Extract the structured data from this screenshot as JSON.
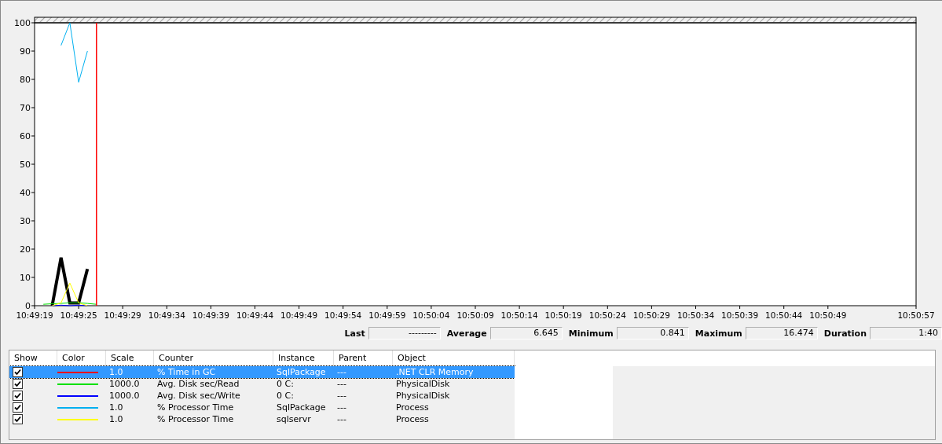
{
  "chart": {
    "cursor": {
      "level": 0.07
    },
    "chart_data": {
      "type": "line",
      "ylim": [
        0,
        100
      ],
      "yticks": [
        0,
        10,
        20,
        30,
        40,
        50,
        60,
        70,
        80,
        90,
        100
      ],
      "categories": [
        "10:49:19",
        null,
        null,
        null,
        null,
        "10:49:25",
        null,
        null,
        null,
        null,
        "10:49:29",
        null,
        null,
        null,
        null,
        "10:49:34",
        null,
        null,
        null,
        null,
        "10:49:39",
        null,
        null,
        null,
        null,
        "10:49:44",
        null,
        null,
        null,
        null,
        "10:49:49",
        null,
        null,
        null,
        null,
        "10:49:54",
        null,
        null,
        null,
        null,
        "10:49:59",
        null,
        null,
        null,
        null,
        "10:50:04",
        null,
        null,
        null,
        null,
        "10:50:09",
        null,
        null,
        null,
        null,
        "10:50:14",
        null,
        null,
        null,
        null,
        "10:50:19",
        null,
        null,
        null,
        null,
        "10:50:24",
        null,
        null,
        null,
        null,
        "10:50:29",
        null,
        null,
        null,
        null,
        "10:50:34",
        null,
        null,
        null,
        null,
        "10:50:39",
        null,
        null,
        null,
        null,
        "10:50:44",
        null,
        null,
        null,
        null,
        "10:50:49",
        null,
        null,
        null,
        null,
        null,
        null,
        null,
        null,
        null,
        "10:50:57"
      ],
      "series": [
        {
          "color": "#000000",
          "values": [
            null,
            null,
            0,
            17,
            1,
            1,
            13,
            null,
            null,
            null,
            null,
            null,
            null,
            null,
            null,
            null,
            null,
            null,
            null,
            null,
            null,
            null,
            null,
            null,
            null,
            null,
            null,
            null,
            null,
            null,
            null,
            null,
            null,
            null,
            null,
            null,
            null,
            null,
            null,
            null,
            null,
            null,
            null,
            null,
            null,
            null,
            null,
            null,
            null,
            null,
            null,
            null,
            null,
            null,
            null,
            null,
            null,
            null,
            null,
            null,
            null,
            null,
            null,
            null,
            null,
            null,
            null,
            null,
            null,
            null,
            null,
            null,
            null,
            null,
            null,
            null,
            null,
            null,
            null,
            null,
            null,
            null,
            null,
            null,
            null,
            null,
            null,
            null,
            null,
            null,
            null,
            null,
            null,
            null,
            null,
            null,
            null,
            null,
            null,
            null,
            null
          ]
        },
        {
          "color": "#00e000",
          "values": [
            null,
            0.5,
            0.7,
            0.8,
            1,
            1,
            0.8,
            0.5,
            null,
            null,
            null,
            null,
            null,
            null,
            null,
            null,
            null,
            null,
            null,
            null,
            null,
            null,
            null,
            null,
            null,
            null,
            null,
            null,
            null,
            null,
            null,
            null,
            null,
            null,
            null,
            null,
            null,
            null,
            null,
            null,
            null,
            null,
            null,
            null,
            null,
            null,
            null,
            null,
            null,
            null,
            null,
            null,
            null,
            null,
            null,
            null,
            null,
            null,
            null,
            null,
            null,
            null,
            null,
            null,
            null,
            null,
            null,
            null,
            null,
            null,
            null,
            null,
            null,
            null,
            null,
            null,
            null,
            null,
            null,
            null,
            null,
            null,
            null,
            null,
            null,
            null,
            null,
            null,
            null,
            null,
            null,
            null,
            null,
            null,
            null,
            null,
            null,
            null,
            null,
            null,
            null
          ]
        },
        {
          "color": "#0000ff",
          "values": [
            null,
            null,
            0,
            0.2,
            0,
            0.2,
            0,
            null,
            null,
            null,
            null,
            null,
            null,
            null,
            null,
            null,
            null,
            null,
            null,
            null,
            null,
            null,
            null,
            null,
            null,
            null,
            null,
            null,
            null,
            null,
            null,
            null,
            null,
            null,
            null,
            null,
            null,
            null,
            null,
            null,
            null,
            null,
            null,
            null,
            null,
            null,
            null,
            null,
            null,
            null,
            null,
            null,
            null,
            null,
            null,
            null,
            null,
            null,
            null,
            null,
            null,
            null,
            null,
            null,
            null,
            null,
            null,
            null,
            null,
            null,
            null,
            null,
            null,
            null,
            null,
            null,
            null,
            null,
            null,
            null,
            null,
            null,
            null,
            null,
            null,
            null,
            null,
            null,
            null,
            null,
            null,
            null,
            null,
            null,
            null,
            null,
            null,
            null,
            null,
            null,
            null
          ]
        },
        {
          "color": "#00b0f0",
          "values": [
            null,
            null,
            null,
            92,
            100,
            79,
            90,
            null,
            null,
            null,
            null,
            null,
            null,
            null,
            null,
            null,
            null,
            null,
            null,
            null,
            null,
            null,
            null,
            null,
            null,
            null,
            null,
            null,
            null,
            null,
            null,
            null,
            null,
            null,
            null,
            null,
            null,
            null,
            null,
            null,
            null,
            null,
            null,
            null,
            null,
            null,
            null,
            null,
            null,
            null,
            null,
            null,
            null,
            null,
            null,
            null,
            null,
            null,
            null,
            null,
            null,
            null,
            null,
            null,
            null,
            null,
            null,
            null,
            null,
            null,
            null,
            null,
            null,
            null,
            null,
            null,
            null,
            null,
            null,
            null,
            null,
            null,
            null,
            null,
            null,
            null,
            null,
            null,
            null,
            null,
            null,
            null,
            null,
            null,
            null,
            null,
            null,
            null,
            null,
            null,
            null
          ]
        },
        {
          "color": "#ffff00",
          "values": [
            null,
            null,
            0,
            1,
            8,
            1,
            0,
            null,
            null,
            null,
            null,
            null,
            null,
            null,
            null,
            null,
            null,
            null,
            null,
            null,
            null,
            null,
            null,
            null,
            null,
            null,
            null,
            null,
            null,
            null,
            null,
            null,
            null,
            null,
            null,
            null,
            null,
            null,
            null,
            null,
            null,
            null,
            null,
            null,
            null,
            null,
            null,
            null,
            null,
            null,
            null,
            null,
            null,
            null,
            null,
            null,
            null,
            null,
            null,
            null,
            null,
            null,
            null,
            null,
            null,
            null,
            null,
            null,
            null,
            null,
            null,
            null,
            null,
            null,
            null,
            null,
            null,
            null,
            null,
            null,
            null,
            null,
            null,
            null,
            null,
            null,
            null,
            null,
            null,
            null,
            null,
            null,
            null,
            null,
            null,
            null,
            null,
            null,
            null,
            null,
            null
          ]
        }
      ]
    }
  },
  "stats": [
    {
      "label": "Last",
      "value": "---------"
    },
    {
      "label": "Average",
      "value": "6.645"
    },
    {
      "label": "Minimum",
      "value": "0.841"
    },
    {
      "label": "Maximum",
      "value": "16.474"
    },
    {
      "label": "Duration",
      "value": "1:40"
    }
  ],
  "table": {
    "columns": [
      "Show",
      "Color",
      "Scale",
      "Counter",
      "Instance",
      "Parent",
      "Object"
    ],
    "rows": [
      {
        "checked": true,
        "selected": true,
        "color": "#ff0000",
        "scale": "1.0",
        "counter": "% Time in GC",
        "instance": "SqlPackage",
        "parent": "---",
        "object": ".NET CLR Memory"
      },
      {
        "checked": true,
        "selected": false,
        "color": "#00e000",
        "scale": "1000.0",
        "counter": "Avg. Disk sec/Read",
        "instance": "0 C:",
        "parent": "---",
        "object": "PhysicalDisk"
      },
      {
        "checked": true,
        "selected": false,
        "color": "#0000ff",
        "scale": "1000.0",
        "counter": "Avg. Disk sec/Write",
        "instance": "0 C:",
        "parent": "---",
        "object": "PhysicalDisk"
      },
      {
        "checked": true,
        "selected": false,
        "color": "#00b0f0",
        "scale": "1.0",
        "counter": "% Processor Time",
        "instance": "SqlPackage",
        "parent": "---",
        "object": "Process"
      },
      {
        "checked": true,
        "selected": false,
        "color": "#ffff00",
        "scale": "1.0",
        "counter": "% Processor Time",
        "instance": "sqlservr",
        "parent": "---",
        "object": "Process"
      }
    ]
  }
}
